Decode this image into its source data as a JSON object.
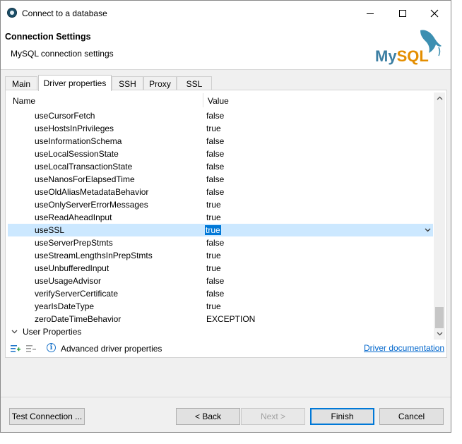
{
  "window": {
    "title": "Connect to a database"
  },
  "header": {
    "title": "Connection Settings",
    "subtitle": "MySQL connection settings",
    "logo_text": "MySQL"
  },
  "tabs": [
    {
      "label": "Main"
    },
    {
      "label": "Driver properties",
      "active": true
    },
    {
      "label": "SSH"
    },
    {
      "label": "Proxy"
    },
    {
      "label": "SSL"
    }
  ],
  "table": {
    "columns": {
      "name": "Name",
      "value": "Value"
    },
    "rows": [
      {
        "name": "useCursorFetch",
        "value": "false"
      },
      {
        "name": "useHostsInPrivileges",
        "value": "true"
      },
      {
        "name": "useInformationSchema",
        "value": "false"
      },
      {
        "name": "useLocalSessionState",
        "value": "false"
      },
      {
        "name": "useLocalTransactionState",
        "value": "false"
      },
      {
        "name": "useNanosForElapsedTime",
        "value": "false"
      },
      {
        "name": "useOldAliasMetadataBehavior",
        "value": "false"
      },
      {
        "name": "useOnlyServerErrorMessages",
        "value": "true"
      },
      {
        "name": "useReadAheadInput",
        "value": "true"
      },
      {
        "name": "useSSL",
        "value": "true",
        "selected": true
      },
      {
        "name": "useServerPrepStmts",
        "value": "false"
      },
      {
        "name": "useStreamLengthsInPrepStmts",
        "value": "true"
      },
      {
        "name": "useUnbufferedInput",
        "value": "true"
      },
      {
        "name": "useUsageAdvisor",
        "value": "false"
      },
      {
        "name": "verifyServerCertificate",
        "value": "false"
      },
      {
        "name": "yearIsDateType",
        "value": "true"
      },
      {
        "name": "zeroDateTimeBehavior",
        "value": "EXCEPTION"
      }
    ],
    "group": {
      "label": "User Properties"
    }
  },
  "bottom": {
    "advanced_label": "Advanced driver properties",
    "doc_link": "Driver documentation"
  },
  "buttons": {
    "test_connection": "Test Connection ...",
    "back": "< Back",
    "next": "Next >",
    "finish": "Finish",
    "cancel": "Cancel"
  },
  "colors": {
    "selection": "#cce8ff",
    "highlight": "#0078d7",
    "link": "#0066cc"
  }
}
